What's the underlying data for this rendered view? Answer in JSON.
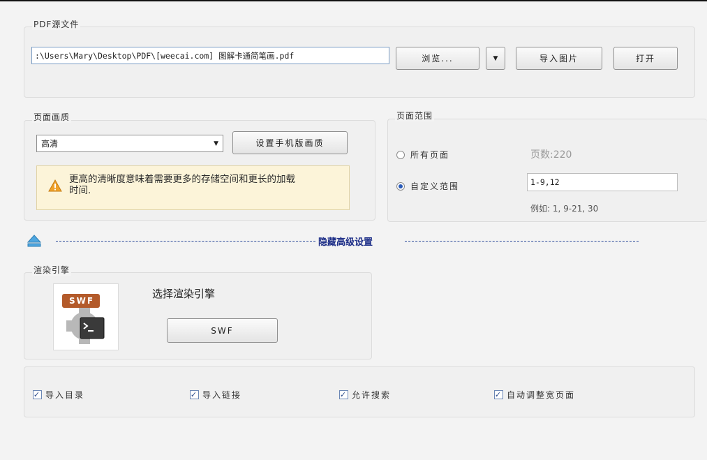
{
  "source": {
    "group_label": "PDF源文件",
    "path_value": ":\\Users\\Mary\\Desktop\\PDF\\[weecai.com] 图解卡通简笔画.pdf",
    "browse_label": "浏览...",
    "dropdown_glyph": "▼",
    "import_images_label": "导入图片",
    "open_label": "打开"
  },
  "quality": {
    "group_label": "页面画质",
    "selected": "高清",
    "mobile_button_label": "设置手机版画质",
    "warning_text": "更高的清晰度意味着需要更多的存储空间和更长的加载时间."
  },
  "range": {
    "group_label": "页面范围",
    "all_pages_label": "所有页面",
    "page_count": "页数:220",
    "custom_label": "自定义范围",
    "custom_value": "1-9,12",
    "example": "例如: 1, 9-21, 30",
    "selected": "custom"
  },
  "advanced": {
    "toggle_label": "隐藏高级设置"
  },
  "render": {
    "group_label": "渲染引擎",
    "engine_badge": "SWF",
    "select_label": "选择渲染引擎",
    "engine_button_label": "SWF"
  },
  "options": {
    "items": [
      {
        "label": "导入目录",
        "checked": true
      },
      {
        "label": "导入链接",
        "checked": true
      },
      {
        "label": "允许搜索",
        "checked": true
      },
      {
        "label": "自动调整宽页面",
        "checked": true
      }
    ]
  },
  "colors": {
    "warning_icon": "#f0a22a",
    "dash": "#2b4a9a",
    "radio_selected": "#2a5bb8"
  }
}
